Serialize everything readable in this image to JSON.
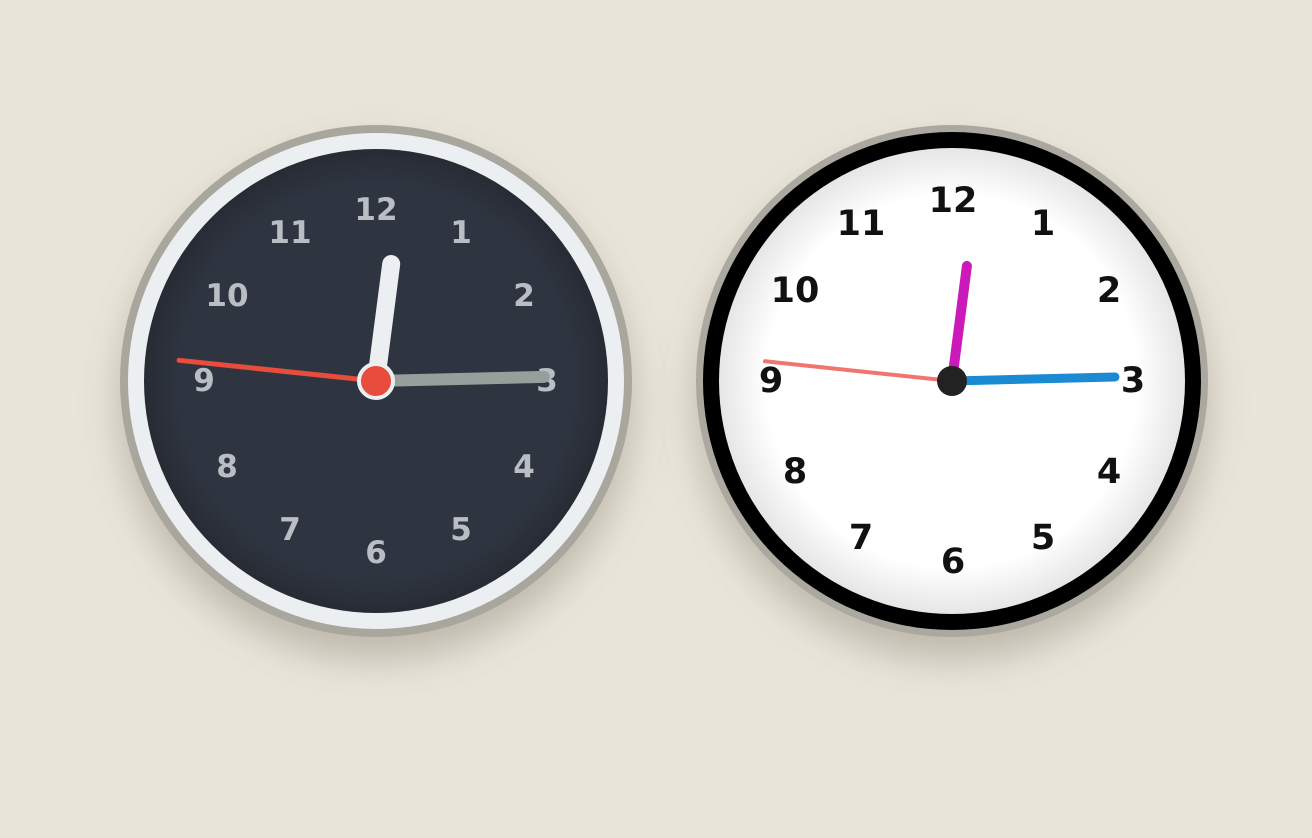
{
  "clocks": [
    {
      "name": "dark-clock",
      "numerals": [
        "12",
        "1",
        "2",
        "3",
        "4",
        "5",
        "6",
        "7",
        "8",
        "9",
        "10",
        "11"
      ],
      "time": {
        "hour": 12,
        "minute": 14,
        "second": 46
      },
      "colors": {
        "face": "#2f3540",
        "rim": "#eceff1",
        "outer_rim": "#a9a69d",
        "numerals": "#b9bec4",
        "hour_hand": "#eceff1",
        "minute_hand": "#95a09c",
        "second_hand": "#e74c3c",
        "center_cap": "#e74c3c",
        "center_cap_ring": "#eceff1"
      }
    },
    {
      "name": "light-clock",
      "numerals": [
        "12",
        "1",
        "2",
        "3",
        "4",
        "5",
        "6",
        "7",
        "8",
        "9",
        "10",
        "11"
      ],
      "time": {
        "hour": 12,
        "minute": 14,
        "second": 46
      },
      "colors": {
        "face": "#ffffff",
        "rim": "#000000",
        "outer_rim": "#aba89f",
        "numerals": "#111111",
        "hour_hand": "#cc19b9",
        "minute_hand": "#1a8ad3",
        "second_hand": "#f07470",
        "center_cap": "#222222",
        "center_cap_ring": "#222222"
      }
    }
  ],
  "background": "#e9e5da"
}
